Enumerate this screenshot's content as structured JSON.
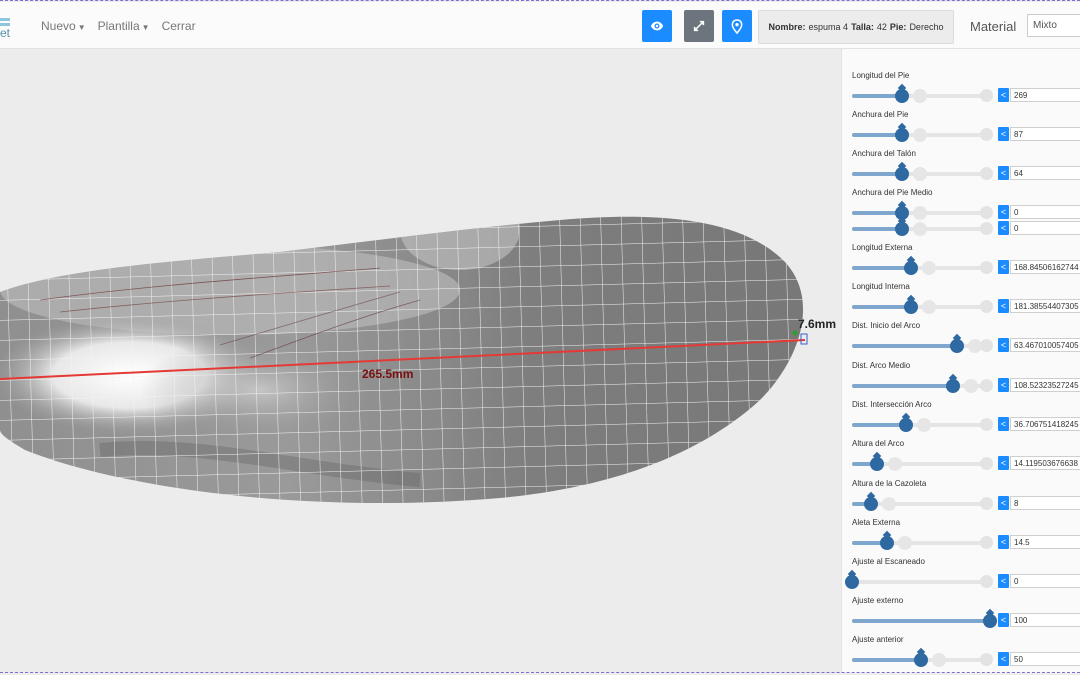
{
  "app": {
    "logo_text": "et"
  },
  "menu": {
    "items": [
      {
        "label": "Nuevo",
        "has_caret": true
      },
      {
        "label": "Plantilla",
        "has_caret": true
      },
      {
        "label": "Cerrar",
        "has_caret": false
      }
    ]
  },
  "toolbar": {
    "view_icon": "eye-icon",
    "expand_icon": "expand-arrows-icon",
    "marker_icon": "map-pin-icon",
    "active_color": "#1a8cff",
    "inactive_color": "#6c757d"
  },
  "info": {
    "nombre_label": "Nombre:",
    "nombre_value": "espuma 4",
    "talla_label": "Talla:",
    "talla_value": "42",
    "pie_label": "Pie:",
    "pie_value": "Derecho"
  },
  "material": {
    "label": "Material",
    "selected": "Mixto"
  },
  "viewport": {
    "length_measure": "265.5mm",
    "edge_measure": "7.6mm"
  },
  "params": [
    {
      "label": "Longitud del Pie",
      "rows": [
        {
          "value": "269",
          "level": 0.36
        }
      ]
    },
    {
      "label": "Anchura del Pie",
      "rows": [
        {
          "value": "87",
          "level": 0.36
        }
      ]
    },
    {
      "label": "Anchura del Talón",
      "rows": [
        {
          "value": "64",
          "level": 0.36
        }
      ]
    },
    {
      "label": "Anchura del Pie Medio",
      "rows": [
        {
          "value": "0",
          "level": 0.36
        },
        {
          "value": "0",
          "level": 0.36
        }
      ]
    },
    {
      "label": "Longitud Externa",
      "rows": [
        {
          "value": "168.84506162744",
          "level": 0.43
        }
      ]
    },
    {
      "label": "Longitud Interna",
      "rows": [
        {
          "value": "181.38554407305",
          "level": 0.43
        }
      ]
    },
    {
      "label": "Dist. Inicio del Arco",
      "rows": [
        {
          "value": "63.467010057405",
          "level": 0.76
        }
      ]
    },
    {
      "label": "Dist. Arco Medio",
      "rows": [
        {
          "value": "108.52323527245",
          "level": 0.73
        }
      ]
    },
    {
      "label": "Dist. Intersección Arco",
      "rows": [
        {
          "value": "36.706751418245",
          "level": 0.39
        }
      ]
    },
    {
      "label": "Altura del Arco",
      "rows": [
        {
          "value": "14.119503676638",
          "level": 0.18
        }
      ]
    },
    {
      "label": "Altura de la Cazoleta",
      "rows": [
        {
          "value": "8",
          "level": 0.14
        }
      ]
    },
    {
      "label": "Aleta Externa",
      "rows": [
        {
          "value": "14.5",
          "level": 0.25
        }
      ]
    },
    {
      "label": "Ajuste al Escaneado",
      "rows": [
        {
          "value": "0",
          "level": 0.0
        }
      ]
    },
    {
      "label": "Ajuste externo",
      "rows": [
        {
          "value": "100",
          "level": 1.0
        }
      ]
    },
    {
      "label": "Ajuste anterior",
      "rows": [
        {
          "value": "50",
          "level": 0.5
        }
      ]
    }
  ],
  "decrement_label": "<"
}
